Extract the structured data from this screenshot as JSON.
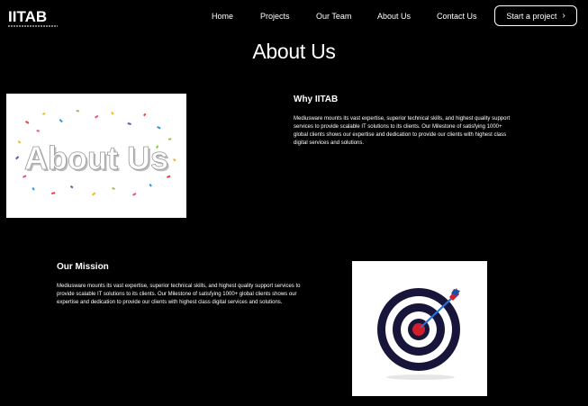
{
  "brand": {
    "logo_text": "IITAB"
  },
  "nav": {
    "items": [
      {
        "label": "Home"
      },
      {
        "label": "Projects"
      },
      {
        "label": "Our Team"
      },
      {
        "label": "About Us"
      },
      {
        "label": "Contact Us"
      }
    ],
    "cta_label": "Start a project",
    "cta_icon": "chevron-right-icon"
  },
  "page": {
    "title": "About Us"
  },
  "about_image": {
    "text": "About Us"
  },
  "why": {
    "heading": "Why IITAB",
    "body": "Mediusware mounts its vast expertise, superior technical skills, and highest quality support services to provide scalable IT solutions to its clients. Our Milestone of satisfying 1000+ global clients shows our expertise and dedication to provide our clients with highest class digital services and solutions."
  },
  "mission": {
    "heading": "Our Mission",
    "body": "Mediusware mounts its vast expertise, superior technical skills, and highest quality support services to provide scalable IT solutions to its clients. Our Milestone of satisfying 1000+ global clients shows our expertise and dedication to provide our clients with highest class digital services and solutions."
  },
  "colors": {
    "background": "#000000",
    "text": "#ffffff",
    "target_ring": "#17163a",
    "target_center": "#d01f2a",
    "arrow": "#2a6fd6"
  }
}
